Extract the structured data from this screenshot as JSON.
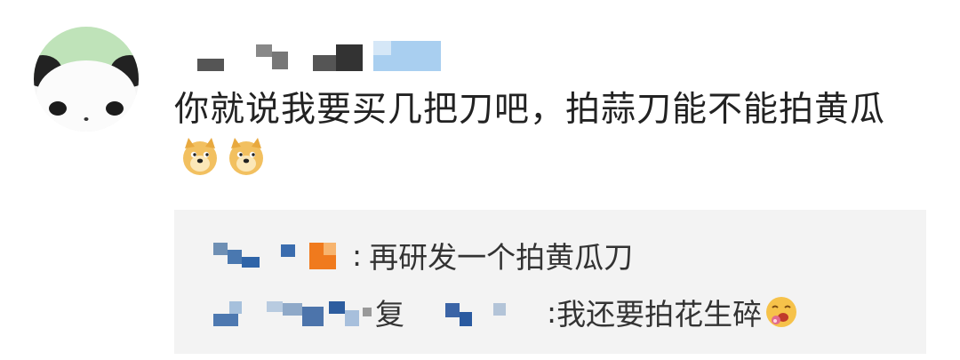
{
  "comment": {
    "text": "你就说我要买几把刀吧，拍蒜刀能不能拍黄瓜",
    "emojis": [
      "doge-emoji",
      "doge-emoji"
    ]
  },
  "replies": [
    {
      "separator": ":",
      "text": "再研发一个拍黄瓜刀"
    },
    {
      "middle_text": "复",
      "separator": ":",
      "text": "我还要拍花生碎",
      "emoji": "drooling-emoji"
    }
  ]
}
